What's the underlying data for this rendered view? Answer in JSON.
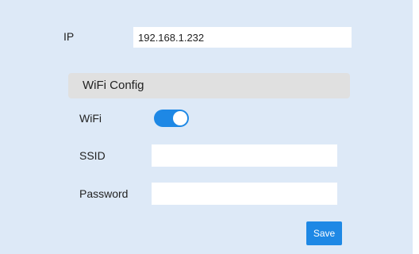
{
  "network": {
    "ip_label": "IP",
    "ip_value": "192.168.1.232"
  },
  "wifi_config": {
    "title": "WiFi Config",
    "wifi_label": "WiFi",
    "wifi_enabled": true,
    "ssid_label": "SSID",
    "ssid_value": "",
    "password_label": "Password",
    "password_value": ""
  },
  "actions": {
    "save_label": "Save"
  },
  "colors": {
    "panel_background": "#dde9f7",
    "section_header_background": "#e0e0e0",
    "accent": "#1e88e5"
  }
}
